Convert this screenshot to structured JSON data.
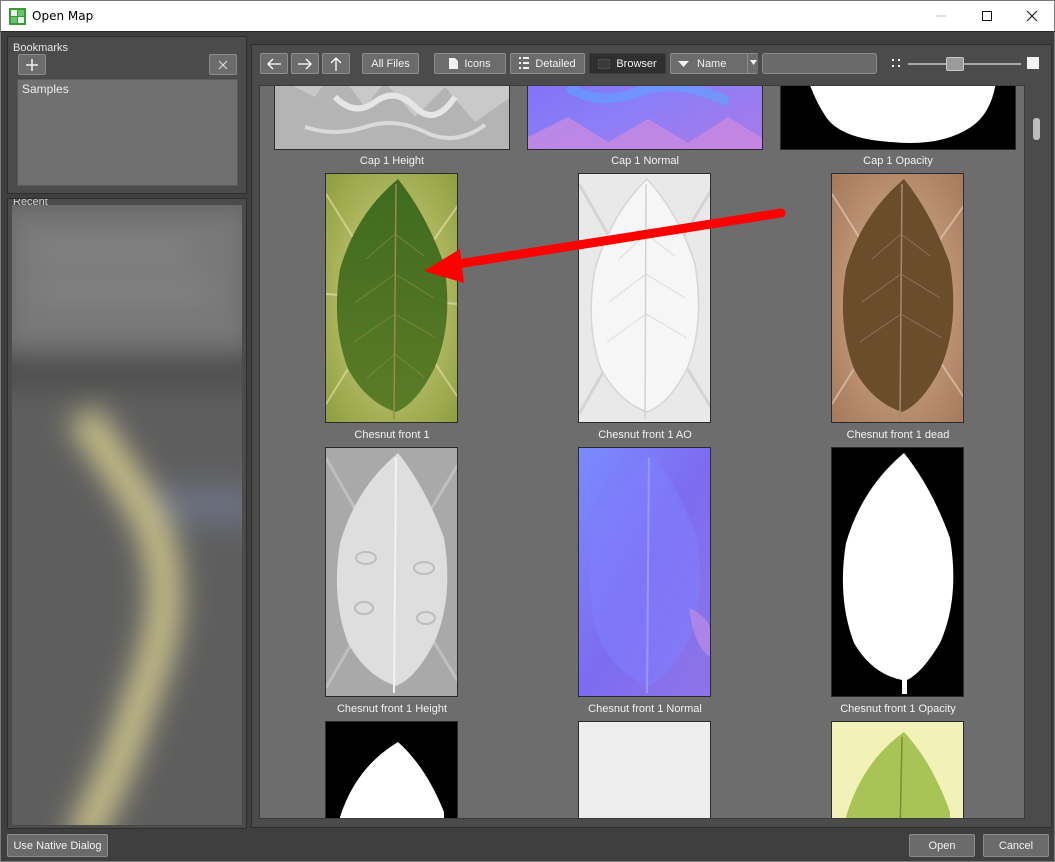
{
  "window": {
    "title": "Open Map",
    "minimize_icon": "minimize-icon",
    "maximize_icon": "maximize-icon",
    "close_icon": "close-icon"
  },
  "bookmarks": {
    "title": "Bookmarks",
    "items": [
      "Samples"
    ]
  },
  "recent": {
    "title": "Recent"
  },
  "toolbar": {
    "all_files": "All Files",
    "icons": "Icons",
    "detailed": "Detailed",
    "browser": "Browser",
    "sort_value": "Name",
    "search_value": ""
  },
  "files": [
    {
      "name": "Cap 1 Height"
    },
    {
      "name": "Cap 1 Normal"
    },
    {
      "name": "Cap 1 Opacity"
    },
    {
      "name": "Chesnut front 1"
    },
    {
      "name": "Chesnut front 1 AO"
    },
    {
      "name": "Chesnut front 1 dead"
    },
    {
      "name": "Chesnut front 1 Height"
    },
    {
      "name": "Chesnut front 1 Normal"
    },
    {
      "name": "Chesnut front 1 Opacity"
    }
  ],
  "footer": {
    "native_dialog": "Use Native Dialog",
    "open": "Open",
    "cancel": "Cancel"
  },
  "colors": {
    "annotation_arrow": "#ff0000",
    "panel": "#4b4b4b",
    "grid_bg": "#6d6d6d"
  }
}
